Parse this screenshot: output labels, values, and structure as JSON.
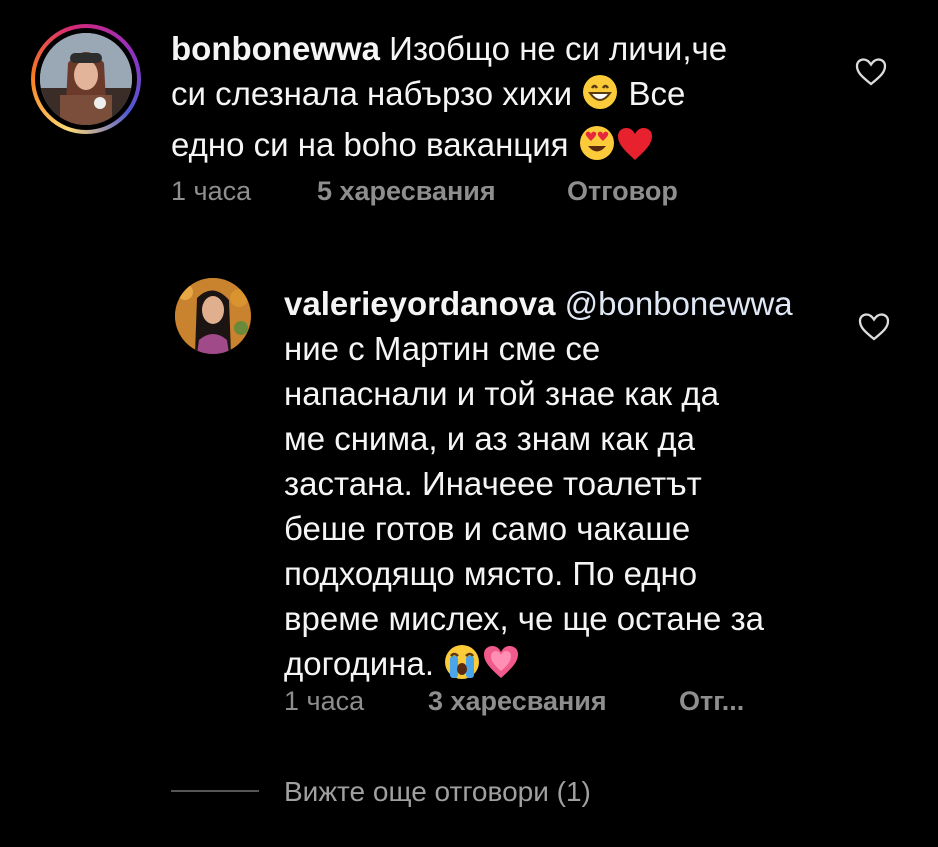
{
  "comment1": {
    "username": "bonbonewwa",
    "text_line1": " Изобщо не си личи,че",
    "text_line2": "си слезнала набързо хихи",
    "text_line2_after": " Все",
    "text_line3": "едно си на boho ваканция",
    "time": "1 часа",
    "likes": "5 харесвания",
    "reply": "Отговор",
    "emoji_1": "grinning-face",
    "emoji_2": "heart-eyes-face",
    "emoji_3": "red-heart"
  },
  "comment2": {
    "username": "valerieyordanova",
    "mention": " @bonbonewwa",
    "lines": [
      "ние с Мартин сме се",
      "напаснали и той знае как да",
      "ме снима, и аз знам как да",
      "застана. Иначеее тоалетът",
      "беше готов и само чакаше",
      "подходящо място. По едно",
      "време мислех, че ще остане за"
    ],
    "last_line": "догодина. ",
    "time": "1 часа",
    "likes": "3 харесвания",
    "reply": "Отг...",
    "emoji_1": "crying-face",
    "emoji_2": "growing-heart"
  },
  "more_replies": "Вижте още отговори (1)",
  "colors": {
    "background": "#000000",
    "text": "#f5f5f5",
    "meta": "#8e8e8e"
  }
}
